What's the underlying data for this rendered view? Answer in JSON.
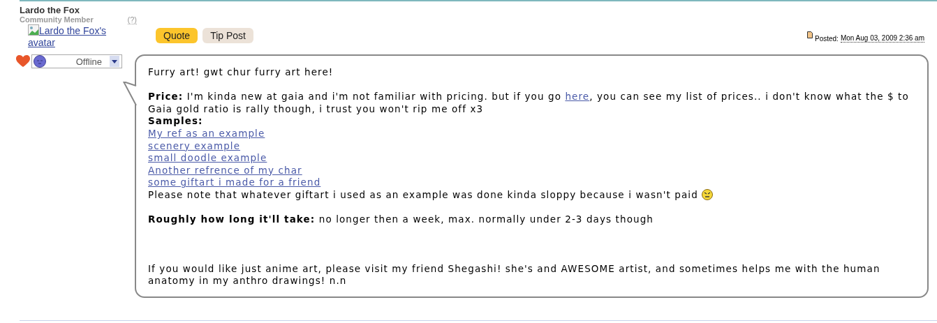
{
  "user": {
    "name": "Lardo the Fox",
    "rank": "Community Member",
    "help": "(?)",
    "avatar_alt": "Lardo the Fox's avatar",
    "status": "Offline"
  },
  "buttons": [
    {
      "label": "Quote",
      "kind": "primary"
    },
    {
      "label": "Tip Post",
      "kind": "secondary"
    }
  ],
  "posted": {
    "label": "Posted:",
    "date": "Mon Aug 03, 2009 2:36 am"
  },
  "body": [
    {
      "kind": "line",
      "parts": [
        {
          "kind": "text",
          "text": "Furry art! gwt chur furry art here!"
        }
      ]
    },
    {
      "kind": "break"
    },
    {
      "kind": "line",
      "parts": [
        {
          "kind": "bold",
          "text": "Price:"
        },
        {
          "kind": "text",
          "text": " I'm kinda new at gaia and i'm not familiar with pricing. but if you go "
        },
        {
          "kind": "link",
          "text": "here"
        },
        {
          "kind": "text",
          "text": ", you can see my list of prices.. i don't know what the $ to Gaia gold ratio is rally though, i trust you won't rip me off x3"
        }
      ]
    },
    {
      "kind": "line",
      "parts": [
        {
          "kind": "bold",
          "text": "Samples:"
        }
      ]
    },
    {
      "kind": "line",
      "parts": [
        {
          "kind": "link",
          "text": "My ref as an example"
        }
      ]
    },
    {
      "kind": "line",
      "parts": [
        {
          "kind": "link",
          "text": "scenery example"
        }
      ]
    },
    {
      "kind": "line",
      "parts": [
        {
          "kind": "link",
          "text": "small doodle example"
        }
      ]
    },
    {
      "kind": "line",
      "parts": [
        {
          "kind": "link",
          "text": "Another refrence of my char"
        }
      ]
    },
    {
      "kind": "line",
      "parts": [
        {
          "kind": "link",
          "text": "some giftart i made for a friend"
        }
      ]
    },
    {
      "kind": "line",
      "parts": [
        {
          "kind": "text",
          "text": "Please note that whatever giftart i used as an example was done kinda sloppy because i wasn't paid "
        },
        {
          "kind": "emoji"
        }
      ]
    },
    {
      "kind": "break"
    },
    {
      "kind": "line",
      "parts": [
        {
          "kind": "bold",
          "text": "Roughly how long it'll take:"
        },
        {
          "kind": "text",
          "text": " no longer then a week, max. normally under 2-3 days though"
        }
      ]
    },
    {
      "kind": "break"
    },
    {
      "kind": "break"
    },
    {
      "kind": "break"
    },
    {
      "kind": "line",
      "parts": [
        {
          "kind": "text",
          "text": "If you would like just anime art, please visit my friend Shegashi! she's and AWESOME artist, and sometimes helps me with the human anatomy in my anthro drawings! n.n"
        }
      ]
    }
  ]
}
